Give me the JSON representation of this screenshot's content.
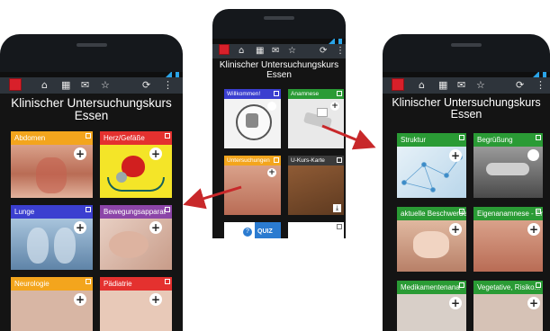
{
  "app": {
    "title_line1": "Klinischer Untersuchungskurs",
    "title_line2": "Essen"
  },
  "actionbar": {
    "icons": [
      "app-logo",
      "home-icon",
      "grid-icon",
      "mail-icon",
      "star-icon",
      "refresh-icon",
      "overflow-menu-icon"
    ]
  },
  "icon_glyphs": {
    "home": "⌂",
    "grid": "▦",
    "mail": "✉",
    "star": "☆",
    "refresh": "⟳",
    "menu": "⋮",
    "plus": "+",
    "download": "⤓"
  },
  "colors": {
    "accent_red": "#c8282a",
    "statusbar_blue": "#2aa4e8",
    "actionbar_bg": "#2e343b"
  },
  "screens": {
    "left": {
      "tiles": [
        {
          "label": "Abdomen",
          "color": "#f3a51d",
          "icon": "plus"
        },
        {
          "label": "Herz/Gefäße",
          "color": "#e4312f",
          "icon": "plus"
        },
        {
          "label": "Lunge",
          "color": "#3b3fd0",
          "icon": "plus"
        },
        {
          "label": "Bewegungsapparat",
          "color": "#8c45a8",
          "icon": "plus"
        },
        {
          "label": "Neurologie",
          "color": "#f3a51d",
          "icon": "plus"
        },
        {
          "label": "Pädiatrie",
          "color": "#e4312f",
          "icon": "plus"
        }
      ]
    },
    "center": {
      "tiles": [
        {
          "label": "Willkommen!",
          "color": "#3b3fd0",
          "icon": "document"
        },
        {
          "label": "Anamnese",
          "color": "#2a9b35",
          "icon": "plus"
        },
        {
          "label": "Untersuchungen",
          "color": "#f3a51d",
          "icon": "plus"
        },
        {
          "label": "U-Kurs-Karte",
          "color": "#3a3a3a",
          "icon": "download"
        },
        {
          "label": "",
          "color": "#ffffff",
          "icon": "quiz"
        },
        {
          "label": "",
          "color": "#ffffff",
          "icon": "blank"
        }
      ],
      "quiz": {
        "badge": "?",
        "label": "QUIZ"
      }
    },
    "right": {
      "tiles": [
        {
          "label": "Struktur",
          "color": "#2a9b35",
          "icon": "plus"
        },
        {
          "label": "Begrüßung",
          "color": "#2a9b35",
          "icon": "document"
        },
        {
          "label": "aktuelle Beschwerden",
          "color": "#2a9b35",
          "icon": "plus"
        },
        {
          "label": "Eigenanamnese - Er",
          "color": "#2a9b35",
          "icon": "plus"
        },
        {
          "label": "Medikamentenana",
          "color": "#2a9b35",
          "icon": "plus"
        },
        {
          "label": "Vegetative, Risiko...",
          "color": "#2a9b35",
          "icon": "plus"
        }
      ]
    }
  }
}
